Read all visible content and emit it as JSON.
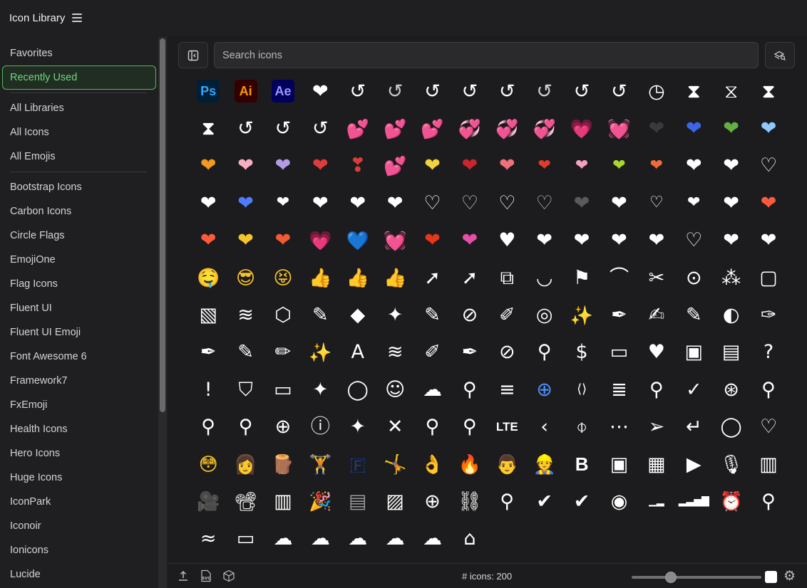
{
  "app": {
    "title": "Icon Library"
  },
  "sidebar": {
    "groups": [
      [
        "Favorites",
        "Recently Used"
      ],
      [
        "All Libraries",
        "All Icons",
        "All Emojis"
      ],
      [
        "Bootstrap Icons",
        "Carbon Icons",
        "Circle Flags",
        "EmojiOne",
        "Flag Icons",
        "Fluent UI",
        "Fluent UI Emoji",
        "Font Awesome 6",
        "Framework7",
        "FxEmoji",
        "Health Icons",
        "Hero Icons",
        "Huge Icons",
        "IconPark",
        "Iconoir",
        "Ionicons",
        "Lucide"
      ]
    ],
    "active": "Recently Used",
    "accent_color": "#4cbb5f",
    "scroll_fraction": 0.68
  },
  "search": {
    "placeholder": "Search icons",
    "value": ""
  },
  "colors": {
    "badge_ps": "#31a8ff",
    "badge_ai": "#ff9a00",
    "badge_ae": "#9999ff"
  },
  "icons": [
    [
      {
        "k": "badge",
        "t": "Ps",
        "n": "photoshop-icon"
      },
      {
        "k": "badge",
        "t": "Ai",
        "n": "illustrator-icon"
      },
      {
        "k": "badge",
        "t": "Ae",
        "n": "after-effects-icon"
      },
      {
        "g": "❤",
        "c": "#ffffff",
        "n": "heart-icon"
      },
      {
        "g": "↺",
        "c": "#ffffff",
        "n": "history-icon"
      },
      {
        "g": "↺",
        "c": "#c8c8c8",
        "n": "history-icon"
      },
      {
        "g": "↺",
        "c": "#ffffff",
        "n": "history-icon"
      },
      {
        "g": "↺",
        "c": "#ffffff",
        "n": "history-icon"
      },
      {
        "g": "↺",
        "c": "#ffffff",
        "n": "history-icon"
      },
      {
        "g": "↺",
        "c": "#d0d0d0",
        "n": "history-icon"
      },
      {
        "g": "↺",
        "c": "#ffffff",
        "n": "history-icon"
      },
      {
        "g": "↺",
        "c": "#ffffff",
        "n": "history-icon"
      },
      {
        "g": "◷",
        "c": "#ffffff",
        "n": "clock-icon"
      },
      {
        "g": "⧗",
        "c": "#ffffff",
        "n": "hourglass-icon"
      },
      {
        "g": "⧖",
        "c": "#ffffff",
        "n": "hourglass-icon"
      },
      {
        "g": "⧗",
        "c": "#ffffff",
        "n": "hourglass-icon"
      }
    ],
    [
      {
        "g": "⧗",
        "c": "#ffffff",
        "n": "hourglass-icon"
      },
      {
        "g": "↺",
        "c": "#ffffff",
        "n": "history-icon"
      },
      {
        "g": "↺",
        "c": "#ffffff",
        "n": "history-icon"
      },
      {
        "g": "↺",
        "c": "#ffffff",
        "n": "history-icon"
      },
      {
        "g": "💕",
        "c": "#ff5a5a",
        "n": "two-hearts-icon",
        "e": 1
      },
      {
        "g": "💕",
        "c": "#ff5a5a",
        "n": "two-hearts-icon",
        "e": 1
      },
      {
        "g": "💕",
        "c": "#ff7b7b",
        "n": "two-hearts-icon",
        "e": 1
      },
      {
        "g": "💞",
        "c": "#ff6a7a",
        "n": "revolving-hearts-icon",
        "e": 1
      },
      {
        "g": "💞",
        "c": "#ff6a7a",
        "n": "revolving-hearts-icon",
        "e": 1
      },
      {
        "g": "💞",
        "c": "#ff88b0",
        "n": "revolving-hearts-icon",
        "e": 1
      },
      {
        "g": "💗",
        "c": "#ff4f8a",
        "n": "growing-heart-icon",
        "e": 1
      },
      {
        "g": "💓",
        "c": "#ff6aa0",
        "n": "beating-heart-icon",
        "e": 1
      },
      {
        "g": "❤",
        "c": "#3a3a3a",
        "n": "black-heart-icon"
      },
      {
        "g": "❤",
        "c": "#3b66e8",
        "n": "blue-heart-icon"
      },
      {
        "g": "❤",
        "c": "#62b044",
        "n": "green-heart-icon"
      },
      {
        "g": "❤",
        "c": "#8fc7ff",
        "n": "light-blue-heart-icon"
      }
    ],
    [
      {
        "g": "❤",
        "c": "#f39a1f",
        "n": "orange-heart-icon"
      },
      {
        "g": "❤",
        "c": "#f4b0c0",
        "n": "pink-heart-icon"
      },
      {
        "g": "❤",
        "c": "#b49be6",
        "n": "purple-heart-icon"
      },
      {
        "g": "❤",
        "c": "#e03b3b",
        "n": "red-heart-icon"
      },
      {
        "g": "❣",
        "c": "#e03b3b",
        "n": "heart-exclamation-icon"
      },
      {
        "g": "💕",
        "c": "#e84040",
        "n": "two-hearts-icon",
        "e": 1
      },
      {
        "g": "❤",
        "c": "#f2d23c",
        "n": "yellow-heart-icon"
      },
      {
        "g": "❤",
        "c": "#c8262b",
        "n": "red-heart-icon"
      },
      {
        "g": "❤",
        "c": "#f0707c",
        "n": "red-heart-icon"
      },
      {
        "g": "❤",
        "c": "#e03b2c",
        "n": "small-heart-icon",
        "s": 22
      },
      {
        "g": "❤",
        "c": "#f4a0c0",
        "n": "small-heart-icon",
        "s": 22
      },
      {
        "g": "❤",
        "c": "#a8d82c",
        "n": "small-heart-icon",
        "s": 22
      },
      {
        "g": "❤",
        "c": "#f06a3c",
        "n": "small-heart-icon",
        "s": 22
      },
      {
        "g": "❤",
        "c": "#ffffff",
        "n": "heart-icon"
      },
      {
        "g": "❤",
        "c": "#ffffff",
        "n": "heart-icon"
      },
      {
        "g": "♡",
        "c": "#ffffff",
        "n": "heart-outline-icon"
      }
    ],
    [
      {
        "g": "❤",
        "c": "#ffffff",
        "n": "heart-icon"
      },
      {
        "g": "❤",
        "c": "#4d7cff",
        "n": "blue-heart-icon"
      },
      {
        "g": "❤",
        "c": "#ffffff",
        "n": "heart-icon",
        "s": 22
      },
      {
        "g": "❤",
        "c": "#ffffff",
        "n": "heart-icon"
      },
      {
        "g": "❤",
        "c": "#ffffff",
        "n": "heart-icon"
      },
      {
        "g": "❤",
        "c": "#ffffff",
        "n": "heart-icon"
      },
      {
        "g": "♡",
        "c": "#ffffff",
        "n": "heart-outline-icon"
      },
      {
        "g": "♡",
        "c": "#cfcfcf",
        "n": "heart-outline-icon"
      },
      {
        "g": "♡",
        "c": "#ffffff",
        "n": "heart-outline-icon"
      },
      {
        "g": "♡",
        "c": "#bdbdbd",
        "n": "heart-outline-icon"
      },
      {
        "g": "❤",
        "c": "#5a5a5a",
        "n": "heart-icon"
      },
      {
        "g": "❤",
        "c": "#ffffff",
        "n": "heart-icon"
      },
      {
        "g": "♡",
        "c": "#ffffff",
        "n": "heart-outline-icon",
        "s": 22
      },
      {
        "g": "❤",
        "c": "#ffffff",
        "n": "heart-icon",
        "s": 22
      },
      {
        "g": "❤",
        "c": "#ffffff",
        "n": "heart-icon"
      },
      {
        "g": "❤",
        "c": "#ff5a3c",
        "n": "red-heart-icon"
      }
    ],
    [
      {
        "g": "❤",
        "c": "#ff5a3c",
        "n": "sparkling-heart-icon"
      },
      {
        "g": "❤",
        "c": "#f5c62a",
        "n": "yellow-heart-icon"
      },
      {
        "g": "❤",
        "c": "#f25a33",
        "n": "red-heart-icon"
      },
      {
        "g": "💗",
        "c": "#ff5fb0",
        "n": "pink-heart-icon",
        "e": 1
      },
      {
        "g": "💙",
        "c": "#2f6fe0",
        "n": "blue-heart-icon",
        "e": 1
      },
      {
        "g": "💓",
        "c": "#ff4a6e",
        "n": "beating-heart-icon",
        "e": 1
      },
      {
        "g": "❤",
        "c": "#e8361c",
        "n": "red-heart-icon"
      },
      {
        "g": "❤",
        "c": "#e64fa8",
        "n": "pink-heart-icon"
      },
      {
        "g": "♥",
        "c": "#ffffff",
        "n": "heart-circle-icon"
      },
      {
        "g": "❤",
        "c": "#ffffff",
        "n": "heart-half-icon"
      },
      {
        "g": "❤",
        "c": "#ffffff",
        "n": "heart-icon"
      },
      {
        "g": "❤",
        "c": "#ffffff",
        "n": "heart-balloon-icon"
      },
      {
        "g": "❤",
        "c": "#ffffff",
        "n": "heart-icon"
      },
      {
        "g": "♡",
        "c": "#ffffff",
        "n": "heart-outline-icon"
      },
      {
        "g": "❤",
        "c": "#ffffff",
        "n": "heart-icon"
      },
      {
        "g": "❤",
        "c": "#ffffff",
        "n": "heart-icon"
      }
    ],
    [
      {
        "g": "🤤",
        "c": "#f5c22a",
        "n": "drooling-face-icon",
        "e": 1
      },
      {
        "g": "😎",
        "c": "#f5c22a",
        "n": "sunglasses-face-icon",
        "e": 1
      },
      {
        "g": "😝",
        "c": "#f5c22a",
        "n": "squinting-tongue-face-icon",
        "e": 1
      },
      {
        "g": "👍",
        "c": "#f5c22a",
        "n": "thumbs-up-icon",
        "e": 1
      },
      {
        "g": "👍",
        "c": "#f3d2c0",
        "n": "thumbs-up-light-icon",
        "e": 1
      },
      {
        "g": "👍",
        "c": "#f5c22a",
        "n": "thumbs-up-icon",
        "e": 1
      },
      {
        "g": "➚",
        "c": "#ffffff",
        "n": "cursor-click-icon"
      },
      {
        "g": "➚",
        "c": "#ffffff",
        "n": "cursor-icon"
      },
      {
        "g": "⧉",
        "c": "#ffffff",
        "n": "shapes-icon"
      },
      {
        "g": "◡",
        "c": "#ffffff",
        "n": "bezier-icon"
      },
      {
        "g": "⚑",
        "c": "#ffffff",
        "n": "vector-select-icon"
      },
      {
        "g": "⌒",
        "c": "#ffffff",
        "n": "curve-icon"
      },
      {
        "g": "✂",
        "c": "#ffffff",
        "n": "path-cut-icon"
      },
      {
        "g": "⊙",
        "c": "#ffffff",
        "n": "lasso-icon"
      },
      {
        "g": "⁂",
        "c": "#ffffff",
        "n": "nodes-icon"
      },
      {
        "g": "▢",
        "c": "#ffffff",
        "n": "bounding-box-icon"
      }
    ],
    [
      {
        "g": "▧",
        "c": "#ffffff",
        "n": "layers-pattern-icon"
      },
      {
        "g": "≋",
        "c": "#ffffff",
        "n": "layers-icon"
      },
      {
        "g": "⬡",
        "c": "#ffffff",
        "n": "cube-icon"
      },
      {
        "g": "✎",
        "c": "#ffffff",
        "n": "note-edit-icon"
      },
      {
        "g": "◆",
        "c": "#ffffff",
        "n": "shapes-add-icon"
      },
      {
        "g": "✦",
        "c": "#ffffff",
        "n": "sparkle-icon"
      },
      {
        "g": "✎",
        "c": "#ffffff",
        "n": "draw-icon"
      },
      {
        "g": "⊘",
        "c": "#ffffff",
        "n": "edit-circle-icon"
      },
      {
        "g": "✐",
        "c": "#ffffff",
        "n": "ruler-pencil-icon"
      },
      {
        "g": "◎",
        "c": "#ffffff",
        "n": "target-icon"
      },
      {
        "g": "✨",
        "c": "#ffffff",
        "n": "magic-wand-icon",
        "e": 1
      },
      {
        "g": "✒",
        "c": "#ffffff",
        "n": "magic-pen-icon"
      },
      {
        "g": "✍",
        "c": "#ffffff",
        "n": "edit-settings-icon"
      },
      {
        "g": "✎",
        "c": "#ffffff",
        "n": "pencil-icon"
      },
      {
        "g": "◐",
        "c": "#ffffff",
        "n": "edit-profile-icon"
      },
      {
        "g": "✑",
        "c": "#ffffff",
        "n": "feather-icon"
      }
    ],
    [
      {
        "g": "✒",
        "c": "#ffffff",
        "n": "pen-tool-icon"
      },
      {
        "g": "✎",
        "c": "#ffffff",
        "n": "file-edit-icon"
      },
      {
        "g": "✏",
        "c": "#ffffff",
        "n": "pencil-icon"
      },
      {
        "g": "✨",
        "c": "#ffffff",
        "n": "magic-pencil-icon",
        "e": 1
      },
      {
        "g": "A",
        "c": "#ffffff",
        "n": "font-edit-icon"
      },
      {
        "g": "≋",
        "c": "#ffffff",
        "n": "scribble-icon"
      },
      {
        "g": "✐",
        "c": "#ffffff",
        "n": "marker-icon"
      },
      {
        "g": "✒",
        "c": "#ffffff",
        "n": "pen-nib-icon"
      },
      {
        "g": "⊘",
        "c": "#ffffff",
        "n": "pen-off-icon"
      },
      {
        "g": "⚲",
        "c": "#ffffff",
        "n": "search-icon"
      },
      {
        "g": "$",
        "c": "#ffffff",
        "n": "search-dollar-icon"
      },
      {
        "g": "▭",
        "c": "#ffffff",
        "n": "search-card-icon"
      },
      {
        "g": "♥",
        "c": "#ffffff",
        "n": "search-heart-icon"
      },
      {
        "g": "▣",
        "c": "#ffffff",
        "n": "folder-search-icon"
      },
      {
        "g": "▤",
        "c": "#ffffff",
        "n": "search-list-icon"
      },
      {
        "g": "?",
        "c": "#ffffff",
        "n": "search-help-icon"
      }
    ],
    [
      {
        "g": "!",
        "c": "#ffffff",
        "n": "search-alert-icon"
      },
      {
        "g": "⛉",
        "c": "#ffffff",
        "n": "shield-search-icon"
      },
      {
        "g": "▭",
        "c": "#ffffff",
        "n": "search-box-icon"
      },
      {
        "g": "✦",
        "c": "#ffffff",
        "n": "search-sparkle-icon"
      },
      {
        "g": "◯",
        "c": "#ffffff",
        "n": "chat-search-icon"
      },
      {
        "g": "☺",
        "c": "#ffffff",
        "n": "face-search-icon"
      },
      {
        "g": "☁",
        "c": "#ffffff",
        "n": "cloud-search-icon"
      },
      {
        "g": "⚲",
        "c": "#ffffff",
        "n": "search-filled-icon"
      },
      {
        "g": "≡",
        "c": "#ffffff",
        "n": "search-text-icon"
      },
      {
        "g": "⊕",
        "c": "#4d8dff",
        "n": "zoom-in-icon"
      },
      {
        "g": "⟨⟩",
        "c": "#ffffff",
        "n": "search-code-icon",
        "s": 18
      },
      {
        "g": "≣",
        "c": "#ffffff",
        "n": "search-lines-icon"
      },
      {
        "g": "⚲",
        "c": "#ffffff",
        "n": "search-icon"
      },
      {
        "g": "✓",
        "c": "#ffffff",
        "n": "search-check-icon"
      },
      {
        "g": "⊛",
        "c": "#ffffff",
        "n": "search-circle-icon"
      },
      {
        "g": "⚲",
        "c": "#ffffff",
        "n": "search-circle-filled-icon"
      }
    ],
    [
      {
        "g": "⚲",
        "c": "#ffffff",
        "n": "search-icon"
      },
      {
        "g": "⚲",
        "c": "#ffffff",
        "n": "search-icon"
      },
      {
        "g": "⊕",
        "c": "#ffffff",
        "n": "zoom-in-icon"
      },
      {
        "g": "ⓘ",
        "c": "#ffffff",
        "n": "search-info-icon"
      },
      {
        "g": "✦",
        "c": "#ffffff",
        "n": "search-sparkle-icon"
      },
      {
        "g": "✕",
        "c": "#ffffff",
        "n": "search-close-icon"
      },
      {
        "g": "⚲",
        "c": "#ffffff",
        "n": "search-icon"
      },
      {
        "g": "⚲",
        "c": "#ffffff",
        "n": "search-icon"
      },
      {
        "k": "lte",
        "t": "LTE",
        "n": "lte-icon"
      },
      {
        "g": "‹",
        "c": "#ffffff",
        "n": "chevron-left-icon"
      },
      {
        "g": "⌽",
        "c": "#ffffff",
        "n": "camera-icon"
      },
      {
        "g": "⋯",
        "c": "#ffffff",
        "n": "more-horizontal-icon"
      },
      {
        "g": "➢",
        "c": "#ffffff",
        "n": "send-icon"
      },
      {
        "g": "↵",
        "c": "#ffffff",
        "n": "return-icon"
      },
      {
        "g": "◯",
        "c": "#ffffff",
        "n": "chat-bubble-icon"
      },
      {
        "g": "♡",
        "c": "#ffffff",
        "n": "heart-outline-icon"
      }
    ],
    [
      {
        "g": "😳",
        "c": "#f5c22a",
        "n": "flushed-face-icon",
        "e": 1
      },
      {
        "g": "👩",
        "c": "#b57ae0",
        "n": "woman-icon",
        "e": 1
      },
      {
        "g": "🪵",
        "c": "#8b5a2b",
        "n": "wood-icon",
        "e": 1
      },
      {
        "g": "🏋",
        "c": "#e03b3b",
        "n": "weightlifter-icon",
        "e": 1
      },
      {
        "g": "🇫",
        "c": "#1a3fa0",
        "n": "flag-icon",
        "e": 1
      },
      {
        "g": "🤸",
        "c": "#f5c22a",
        "n": "cartwheel-icon",
        "e": 1
      },
      {
        "g": "👌",
        "c": "#f5c22a",
        "n": "ok-hand-icon",
        "e": 1
      },
      {
        "g": "🔥",
        "c": "#ff9a00",
        "n": "fire-icon",
        "e": 1
      },
      {
        "g": "👨",
        "c": "#d8a878",
        "n": "man-icon",
        "e": 1
      },
      {
        "g": "👷",
        "c": "#8a5a3c",
        "n": "mechanic-icon",
        "e": 1
      },
      {
        "k": "lte",
        "t": "B",
        "n": "bold-icon"
      },
      {
        "g": "▣",
        "c": "#ffffff",
        "n": "copy-one-icon"
      },
      {
        "g": "▦",
        "c": "#ffffff",
        "n": "keyboard-icon"
      },
      {
        "g": "▶",
        "c": "#ffffff",
        "n": "video-icon"
      },
      {
        "g": "🎙",
        "c": "#ffffff",
        "n": "microphone-icon",
        "e": 1
      },
      {
        "g": "▥",
        "c": "#ffffff",
        "n": "film-icon"
      }
    ],
    [
      {
        "g": "🎥",
        "c": "#ffffff",
        "n": "video-camera-icon",
        "e": 1
      },
      {
        "g": "📽",
        "c": "#ffffff",
        "n": "film-projector-icon",
        "e": 1
      },
      {
        "g": "▥",
        "c": "#ffffff",
        "n": "film-strip-icon"
      },
      {
        "g": "🎉",
        "c": "#f5c22a",
        "n": "party-popper-icon",
        "e": 1
      },
      {
        "g": "▤",
        "c": "#9a9a9a",
        "n": "books-icon"
      },
      {
        "g": "▨",
        "c": "#ffffff",
        "n": "image-icon"
      },
      {
        "g": "⊕",
        "c": "#ffffff",
        "n": "add-circle-icon"
      },
      {
        "g": "⛓",
        "c": "#ffffff",
        "n": "link-icon"
      },
      {
        "g": "⚲",
        "c": "#ffffff",
        "n": "location-star-icon"
      },
      {
        "g": "✔",
        "c": "#ffffff",
        "n": "verified-badge-icon"
      },
      {
        "g": "✔",
        "c": "#ffffff",
        "n": "verified-badge-icon"
      },
      {
        "g": "◉",
        "c": "#ffffff",
        "n": "user-circle-icon"
      },
      {
        "g": "▁▂",
        "c": "#ffffff",
        "n": "signal-low-icon",
        "s": 14
      },
      {
        "g": "▂▃▅▇",
        "c": "#ffffff",
        "n": "signal-full-icon",
        "s": 14
      },
      {
        "g": "⏰",
        "c": "#ffffff",
        "n": "alarm-icon",
        "e": 1
      },
      {
        "g": "⚲",
        "c": "#ffffff",
        "n": "map-pin-icon"
      }
    ],
    [
      {
        "g": "≈",
        "c": "#ffffff",
        "n": "wifi-icon"
      },
      {
        "g": "▭",
        "c": "#ffffff",
        "n": "battery-icon"
      },
      {
        "g": "☁",
        "c": "#ffffff",
        "n": "cloud-rain-icon"
      },
      {
        "g": "☁",
        "c": "#ffffff",
        "n": "cloud-icon"
      },
      {
        "g": "☁",
        "c": "#ffffff",
        "n": "cloud-icon"
      },
      {
        "g": "☁",
        "c": "#ffffff",
        "n": "cloud-icon"
      },
      {
        "g": "☁",
        "c": "#ffffff",
        "n": "cloud-icon"
      },
      {
        "g": "⌂",
        "c": "#ffffff",
        "n": "barn-icon"
      }
    ]
  ],
  "status": {
    "count_label": "# icons: 200",
    "size_fraction": 0.3
  }
}
